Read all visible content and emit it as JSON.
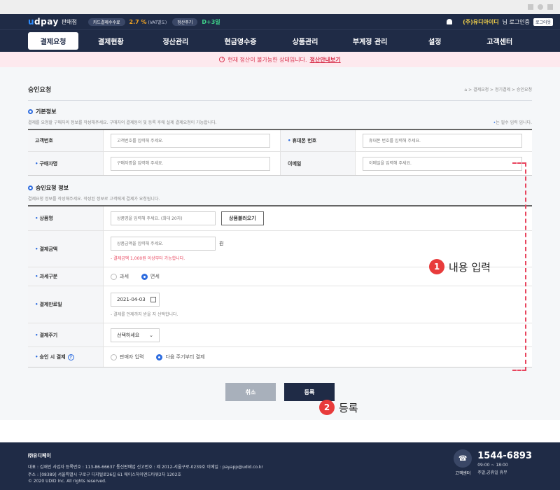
{
  "header": {
    "logo": "udpay",
    "store_label": "판매점",
    "card_fee_label": "카드결제수수료",
    "fee_rate": "2.7 %",
    "vat_note": "(VAT별도)",
    "settle_cycle_label": "정산주기",
    "settle_cycle": "D+3일",
    "user_name": "(주)유디아이디",
    "login_suffix": "님 로그인중",
    "logout_label": "로그아웃"
  },
  "nav": [
    "결제요청",
    "결제현황",
    "정산관리",
    "현금영수증",
    "상품관리",
    "부계정 관리",
    "설정",
    "고객센터"
  ],
  "notice": {
    "text": "현재 정산이 불가능한 상태입니다.",
    "link": "정산안내보기"
  },
  "page": {
    "title": "승인요청",
    "breadcrumb": "⌂ > 결제요청 > 정기결제 > 승인요청"
  },
  "basic": {
    "title": "기본정보",
    "desc": "결제를 요청할 구매자의 정보를 작성해주세요. 구매자의 결제동의 및 등록 후에 실제 결제요청이 가능합니다.",
    "required_note": "는 필수 입력 입니다.",
    "customer_no_label": "고객번호",
    "customer_no_placeholder": "고객번호를 입력해 주세요.",
    "phone_label": "휴대폰 번호",
    "phone_placeholder": "휴대폰 번호를 입력해 주세요.",
    "buyer_label": "구매자명",
    "buyer_placeholder": "구매자명을 입력해 주세요.",
    "email_label": "이메일",
    "email_placeholder": "이메일을 입력해 주세요."
  },
  "approval": {
    "title": "승인요청 정보",
    "desc": "결제요청 정보를 작성해주세요. 작성된 정보로 고객에게 결제가 요청됩니다.",
    "product_label": "상품명",
    "product_placeholder": "상품명을 입력해 주세요. (최대 20자)",
    "product_load": "상품불러오기",
    "amount_label": "결제금액",
    "amount_placeholder": "상품금액을 입력해 주세요.",
    "amount_unit": "원",
    "amount_hint": "- 결제금액 1,000원 이상부터 가능합니다.",
    "tax_label": "과세구분",
    "tax_options": [
      "과세",
      "면세"
    ],
    "date_label": "결제만료일",
    "date_value": "2021-04-03",
    "date_hint": "- 결제를 언제까지 받을 지 선택합니다.",
    "cycle_label": "결제주기",
    "cycle_value": "선택하세요",
    "approve_label": "승인 시 결제",
    "approve_options": [
      "판매자 입력",
      "다음 주기부터 결제"
    ]
  },
  "actions": {
    "cancel": "취소",
    "submit": "등록"
  },
  "annotations": {
    "one_num": "1",
    "one_text": "내용 입력",
    "two_num": "2",
    "two_text": "등록"
  },
  "footer": {
    "company": "㈜유디페이",
    "line1": "대표 : 김재인 사업자 등록번호 : 113-86-66637 통신판매업 신고번호 : 제 2012-서울구로-0239호 이메일 : payapp@udid.co.kr",
    "line2": "주소 : [08389] 서울특별시 구로구 디지털로26길 61 에이스하이엔드타워2차 1202호",
    "copyright": "© 2020 UDID Inc. All rights reserved.",
    "cc_label": "고객센터",
    "tel": "1544-6893",
    "hours": "09:00 ~ 18:00",
    "holiday": "주말,공휴일 휴무"
  }
}
